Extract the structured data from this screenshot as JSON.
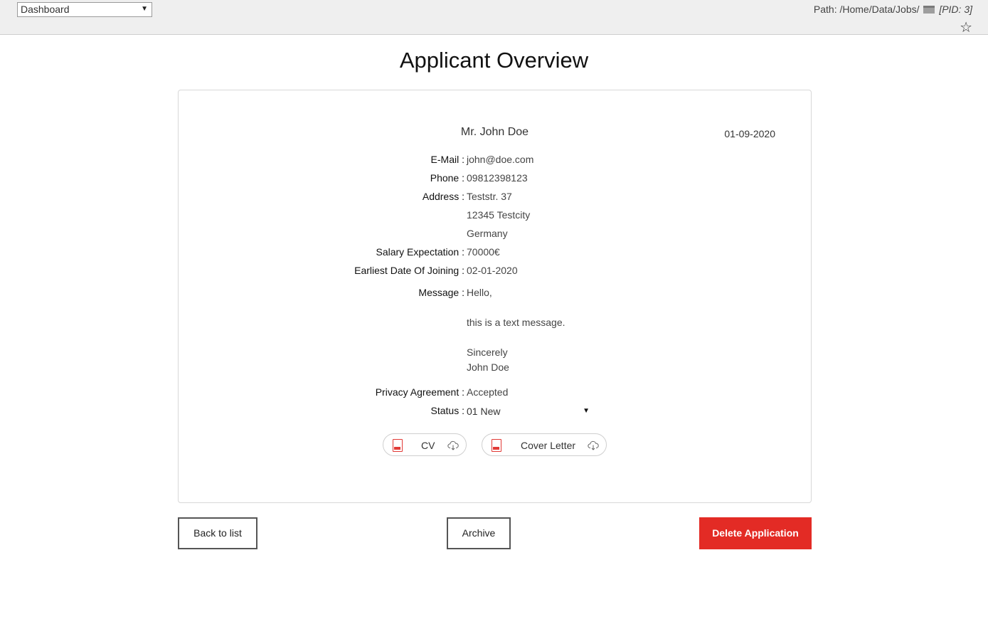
{
  "topbar": {
    "module_select": "Dashboard",
    "path_label": "Path: /Home/Data/Jobs/",
    "pid_label": "[PID: 3]"
  },
  "page_title": "Applicant Overview",
  "applicant": {
    "name": "Mr. John Doe",
    "date": "01-09-2020",
    "fields": {
      "email_label": "E-Mail :",
      "email": "john@doe.com",
      "phone_label": "Phone :",
      "phone": "09812398123",
      "address_label": "Address :",
      "address_line1": "Teststr. 37",
      "address_line2": "12345 Testcity",
      "address_line3": "Germany",
      "salary_label": "Salary Expectation :",
      "salary": "70000€",
      "joining_label": "Earliest Date Of Joining :",
      "joining": "02-01-2020",
      "message_label": "Message :",
      "message_line1": "Hello,",
      "message_line2": "this is a text message.",
      "message_line3": "Sincerely",
      "message_line4": "John Doe",
      "privacy_label": "Privacy Agreement :",
      "privacy": "Accepted",
      "status_label": "Status :",
      "status": "01 New"
    },
    "files": {
      "cv": "CV",
      "cover_letter": "Cover Letter"
    }
  },
  "actions": {
    "back": "Back to list",
    "archive": "Archive",
    "delete": "Delete Application"
  },
  "colors": {
    "danger": "#e32b25",
    "pdf_icon": "#e23a36",
    "topbar_bg": "#efefef"
  }
}
